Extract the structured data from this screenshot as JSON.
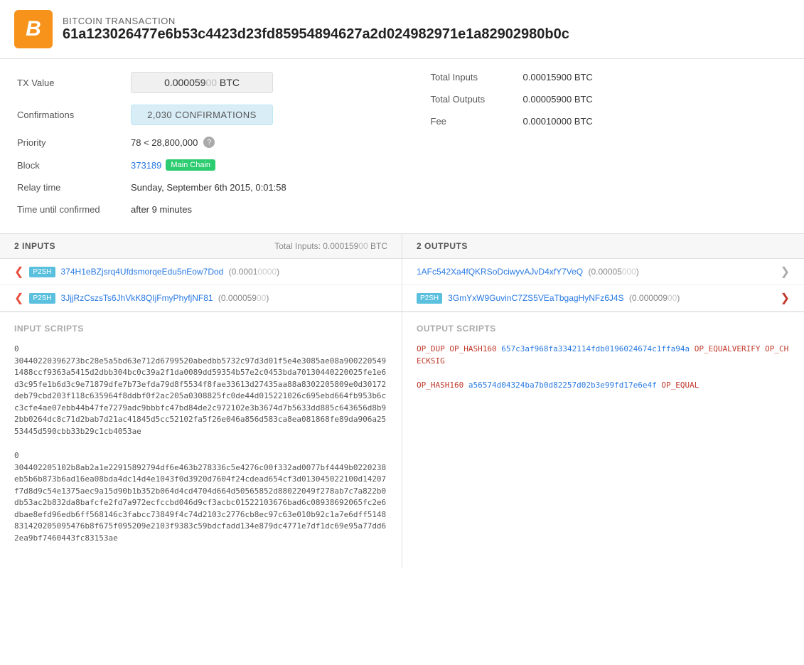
{
  "header": {
    "logo_char": "₿",
    "title": "BITCOIN TRANSACTION",
    "txid": "61a123026477e6b53c4423d23fd85954894627a2d024982971e1a82902980b0c"
  },
  "tx_details": {
    "tx_value_label": "TX Value",
    "tx_value": "0.000059",
    "tx_value_zero": "00",
    "tx_value_unit": " BTC",
    "confirmations_label": "Confirmations",
    "confirmations_text": "2,030 CONFIRMATIONS",
    "priority_label": "Priority",
    "priority_value": "78 < 28,800,000",
    "block_label": "Block",
    "block_number": "373189",
    "block_badge": "Main Chain",
    "relay_label": "Relay time",
    "relay_value": "Sunday, September 6th 2015, 0:01:58",
    "time_label": "Time until confirmed",
    "time_value": "after 9 minutes"
  },
  "right_details": {
    "total_inputs_label": "Total Inputs",
    "total_inputs_val": "0.000159",
    "total_inputs_zero": "00",
    "total_inputs_unit": " BTC",
    "total_outputs_label": "Total Outputs",
    "total_outputs_val": "0.000059",
    "total_outputs_zero": "00",
    "total_outputs_unit": " BTC",
    "fee_label": "Fee",
    "fee_val": "0.0001",
    "fee_zero": "0000",
    "fee_unit": " BTC"
  },
  "inputs_section": {
    "title": "2 INPUTS",
    "total_label": "Total Inputs: 0.000159",
    "total_zero": "00",
    "total_unit": " BTC",
    "rows": [
      {
        "badge": "P2SH",
        "address": "374H1eBZjsrq4UfdsmorqeEdu5nEow7Dod",
        "amount": "(0.0001",
        "amount_zero": "0000",
        "amount_close": ")"
      },
      {
        "badge": "P2SH",
        "address": "3JjjRzCszsTs6JhVkK8QIjFmyPhyfjNF81",
        "amount": "(0.000059",
        "amount_zero": "00",
        "amount_close": ")"
      }
    ]
  },
  "outputs_section": {
    "title": "2 OUTPUTS",
    "rows": [
      {
        "badge": null,
        "address": "1AFc542Xa4fQKRSoDciwyvAJvD4xfY7VeQ",
        "amount": "(0.00005",
        "amount_zero": "000",
        "amount_close": ")"
      },
      {
        "badge": "P2SH",
        "address": "3GmYxW9GuvinC7ZS5VEaTbgagHyNFz6J4S",
        "amount": "(0.000009",
        "amount_zero": "00",
        "amount_close": ")"
      }
    ]
  },
  "input_scripts": {
    "title": "INPUT SCRIPTS",
    "blocks": [
      {
        "index": "0",
        "text": "30440220396273bc28e5a5bd63e712d6799520abedbb5732c97d3d01f5e4e3085ae08a9002205491488ccf9363a5415d2dbb304bc0c39a2f1da0089dd59354b57e2c0453bda70130440220025fe1e6d3c95fe1b6d3c9e71879dfe7b73efda79d8f5534f8fae33613d27435aa88a8302205809e0d30172deb79cbd203f118c635964f8ddbf0f2ac205a0308825fc0de44d015221026c695ebd664fb953b6cc3cfe4ae07ebb44b47fe7279adc9bbbfc47bd84de2c972102e3b3674d7b5633dd885c643656d8b92bb0264dc8c71d2bab7d21ac41845d5cc52102fa5f26e046a856d583ca8ea081868fe89da906a2553445d590cbb33b29c1cb4053ae"
      },
      {
        "index": "0",
        "text": "304402205102b8ab2a1e22915892794df6e463b278336c5e4276c00f332ad0077bf4449b0220238eb5b6b873b6ad16ea08bda4dc14d4e1043f0d3920d7604f24cdead654cf3d013045022100d14207f7d8d9c54e1375aec9a15d90b1b352b064d4cd4704d664d50565852d88022049f278ab7c7a822b0db53ac2b832da8bafcfe2fd7a972ecfccbd046d9cf3acbc01522103676bad6c08938692065fc2e6dbae8efd96edb6ff568146c3fabcc73849f4c74d2103c2776cb8ec97c63e010b92c1a7e6dff5148831420205095476b8f675f095209e2103f9383c59bdcfadd134e879dc4771e7df1dc69e95a77dd62ea9bf7460443fc83153ae"
      }
    ]
  },
  "output_scripts": {
    "title": "OUTPUT SCRIPTS",
    "blocks": [
      {
        "text": "OP_DUP OP_HASH160 657c3af968fa3342114fdb0196024674c1ffa94a OP_EQUALVERIFY OP_CHECKSIG"
      },
      {
        "text": "OP_HASH160 a56574d04324ba7b0d82257d02b3e99fd17e6e4f OP_EQUAL"
      }
    ]
  }
}
